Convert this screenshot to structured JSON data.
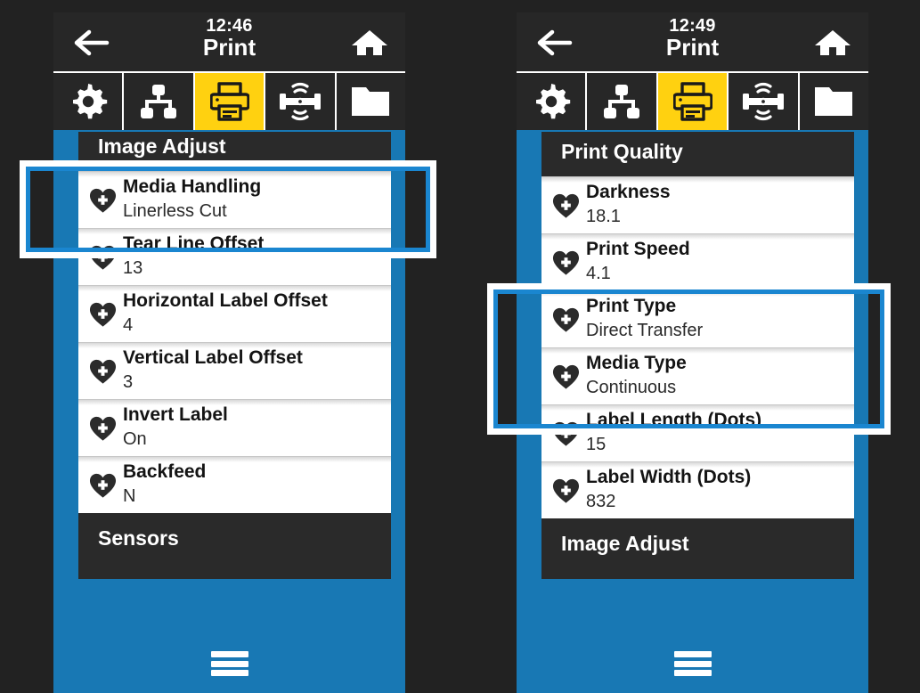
{
  "colors": {
    "page_background": "#222222",
    "device_blue": "#1878b4",
    "bar_dark": "#272727",
    "tab_active_yellow": "#ffd110",
    "callout_outer": "#ffffff",
    "callout_inner": "#1a86d0",
    "row_background": "#ffffff"
  },
  "panels": [
    {
      "id": "left-panel",
      "titlebar": {
        "back_icon": "back-arrow-icon",
        "clock": "12:46",
        "title": "Print",
        "home_icon": "home-icon"
      },
      "tabs": [
        {
          "id": "tab-system",
          "icon": "gear-icon",
          "active": false
        },
        {
          "id": "tab-connection",
          "icon": "network-icon",
          "active": false
        },
        {
          "id": "tab-print",
          "icon": "printer-icon",
          "active": true
        },
        {
          "id": "tab-sensors",
          "icon": "sensor-icon",
          "active": false
        },
        {
          "id": "tab-storage",
          "icon": "folder-icon",
          "active": false
        }
      ],
      "section_header": "Image Adjust",
      "rows": [
        {
          "icon": "add-shortcut-heart-icon",
          "label": "Media Handling",
          "value": "Linerless Cut"
        },
        {
          "icon": "add-shortcut-heart-icon",
          "label": "Tear Line Offset",
          "value": "13"
        },
        {
          "icon": "add-shortcut-heart-icon",
          "label": "Horizontal Label Offset",
          "value": "4"
        },
        {
          "icon": "add-shortcut-heart-icon",
          "label": "Vertical Label Offset",
          "value": "3"
        },
        {
          "icon": "add-shortcut-heart-icon",
          "label": "Invert Label",
          "value": "On"
        },
        {
          "icon": "add-shortcut-heart-icon",
          "label": "Backfeed",
          "value": "N"
        }
      ],
      "section_footer": "Sensors",
      "menu_icon": "hamburger-menu-icon"
    },
    {
      "id": "right-panel",
      "titlebar": {
        "back_icon": "back-arrow-icon",
        "clock": "12:49",
        "title": "Print",
        "home_icon": "home-icon"
      },
      "tabs": [
        {
          "id": "tab-system",
          "icon": "gear-icon",
          "active": false
        },
        {
          "id": "tab-connection",
          "icon": "network-icon",
          "active": false
        },
        {
          "id": "tab-print",
          "icon": "printer-icon",
          "active": true
        },
        {
          "id": "tab-sensors",
          "icon": "sensor-icon",
          "active": false
        },
        {
          "id": "tab-storage",
          "icon": "folder-icon",
          "active": false
        }
      ],
      "section_header": "Print Quality",
      "rows": [
        {
          "icon": "add-shortcut-heart-icon",
          "label": "Darkness",
          "value": "18.1"
        },
        {
          "icon": "add-shortcut-heart-icon",
          "label": "Print Speed",
          "value": "4.1"
        },
        {
          "icon": "add-shortcut-heart-icon",
          "label": "Print Type",
          "value": "Direct Transfer"
        },
        {
          "icon": "add-shortcut-heart-icon",
          "label": "Media Type",
          "value": "Continuous"
        },
        {
          "icon": "add-shortcut-heart-icon",
          "label": "Label Length (Dots)",
          "value": "15"
        },
        {
          "icon": "add-shortcut-heart-icon",
          "label": "Label Width (Dots)",
          "value": "832"
        }
      ],
      "section_footer": "Image Adjust",
      "menu_icon": "hamburger-menu-icon"
    }
  ],
  "callouts": [
    {
      "id": "callout-left",
      "target": "Media Handling row"
    },
    {
      "id": "callout-right",
      "target": "Print Type and Media Type rows"
    }
  ]
}
